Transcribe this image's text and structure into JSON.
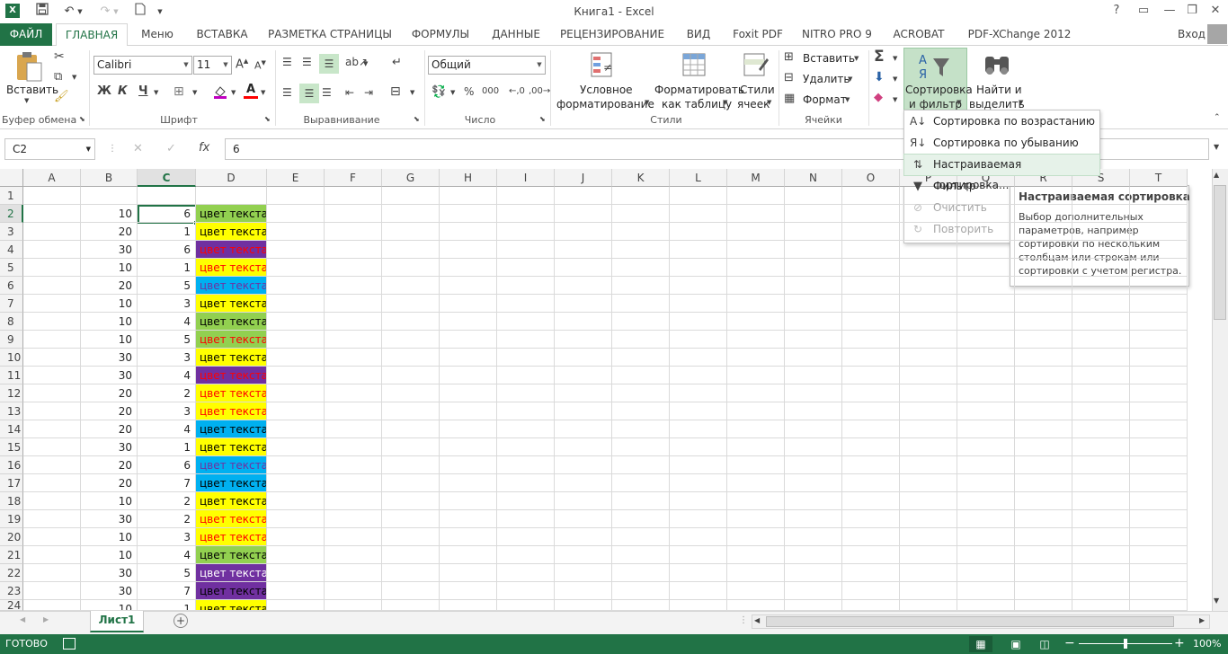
{
  "window": {
    "title": "Книга1 - Excel",
    "help": "?",
    "restore_ribbon": "▭",
    "minimize": "—",
    "maximize": "❐",
    "close": "✕"
  },
  "quick_access": {
    "icons": [
      "excel-logo-icon",
      "save-icon",
      "undo-icon",
      "redo-icon",
      "new-document-icon",
      "customize-icon"
    ]
  },
  "tabs": [
    "ФАЙЛ",
    "ГЛАВНАЯ",
    "Меню",
    "ВСТАВКА",
    "РАЗМЕТКА СТРАНИЦЫ",
    "ФОРМУЛЫ",
    "ДАННЫЕ",
    "РЕЦЕНЗИРОВАНИЕ",
    "ВИД",
    "Foxit PDF",
    "NITRO PRO 9",
    "ACROBAT",
    "PDF-XChange 2012"
  ],
  "account": {
    "login": "Вход"
  },
  "ribbon": {
    "clipboard": {
      "paste": "Вставить",
      "label": "Буфер обмена"
    },
    "font": {
      "name": "Calibri",
      "size": "11",
      "bold": "Ж",
      "italic": "К",
      "underline": "Ч",
      "font_color_letter": "A",
      "label": "Шрифт"
    },
    "alignment": {
      "label": "Выравнивание"
    },
    "number": {
      "format": "Общий",
      "percent": "%",
      "thousands": "000",
      "label": "Число"
    },
    "styles": {
      "conditional_1": "Условное",
      "conditional_2": "форматирование",
      "format_table_1": "Форматировать",
      "format_table_2": "как таблицу",
      "cell_styles_1": "Стили",
      "cell_styles_2": "ячеек",
      "label": "Стили"
    },
    "cells": {
      "insert": "Вставить",
      "delete": "Удалить",
      "format": "Формат",
      "label": "Ячейки"
    },
    "editing": {
      "sort_1": "Сортировка",
      "sort_2": "и фильтр",
      "find_1": "Найти и",
      "find_2": "выделить",
      "autosum": "Σ"
    }
  },
  "formula_bar": {
    "name_box": "C2",
    "cancel": "✕",
    "enter": "✓",
    "fx": "fx",
    "value": "6"
  },
  "columns": [
    "A",
    "B",
    "C",
    "D",
    "E",
    "F",
    "G",
    "H",
    "I",
    "J",
    "K",
    "L",
    "M",
    "N",
    "O",
    "P",
    "Q",
    "R",
    "S",
    "T"
  ],
  "rows": [
    {
      "n": "1",
      "b": "",
      "c": "",
      "d": "",
      "fill": "",
      "color": ""
    },
    {
      "n": "2",
      "b": "10",
      "c": "6",
      "d": "цвет текста",
      "fill": "#92d050",
      "color": "#000000"
    },
    {
      "n": "3",
      "b": "20",
      "c": "1",
      "d": "цвет текста",
      "fill": "#ffff00",
      "color": "#000000"
    },
    {
      "n": "4",
      "b": "30",
      "c": "6",
      "d": "цвет текста",
      "fill": "#7030a0",
      "color": "#ff0000"
    },
    {
      "n": "5",
      "b": "10",
      "c": "1",
      "d": "цвет текста",
      "fill": "#ffff00",
      "color": "#ff0000"
    },
    {
      "n": "6",
      "b": "20",
      "c": "5",
      "d": "цвет текста",
      "fill": "#00b0f0",
      "color": "#7030a0"
    },
    {
      "n": "7",
      "b": "10",
      "c": "3",
      "d": "цвет текста",
      "fill": "#ffff00",
      "color": "#000000"
    },
    {
      "n": "8",
      "b": "10",
      "c": "4",
      "d": "цвет текста",
      "fill": "#92d050",
      "color": "#000000"
    },
    {
      "n": "9",
      "b": "10",
      "c": "5",
      "d": "цвет текста",
      "fill": "#92d050",
      "color": "#ff0000"
    },
    {
      "n": "10",
      "b": "30",
      "c": "3",
      "d": "цвет текста",
      "fill": "#ffff00",
      "color": "#000000"
    },
    {
      "n": "11",
      "b": "30",
      "c": "4",
      "d": "цвет текста",
      "fill": "#7030a0",
      "color": "#ff0000"
    },
    {
      "n": "12",
      "b": "20",
      "c": "2",
      "d": "цвет текста",
      "fill": "#ffff00",
      "color": "#ff0000"
    },
    {
      "n": "13",
      "b": "20",
      "c": "3",
      "d": "цвет текста",
      "fill": "#ffff00",
      "color": "#ff0000"
    },
    {
      "n": "14",
      "b": "20",
      "c": "4",
      "d": "цвет текста",
      "fill": "#00b0f0",
      "color": "#000000"
    },
    {
      "n": "15",
      "b": "30",
      "c": "1",
      "d": "цвет текста",
      "fill": "#ffff00",
      "color": "#000000"
    },
    {
      "n": "16",
      "b": "20",
      "c": "6",
      "d": "цвет текста",
      "fill": "#00b0f0",
      "color": "#7030a0"
    },
    {
      "n": "17",
      "b": "20",
      "c": "7",
      "d": "цвет текста",
      "fill": "#00b0f0",
      "color": "#000000"
    },
    {
      "n": "18",
      "b": "10",
      "c": "2",
      "d": "цвет текста",
      "fill": "#ffff00",
      "color": "#000000"
    },
    {
      "n": "19",
      "b": "30",
      "c": "2",
      "d": "цвет текста",
      "fill": "#ffff00",
      "color": "#ff0000"
    },
    {
      "n": "20",
      "b": "10",
      "c": "3",
      "d": "цвет текста",
      "fill": "#ffff00",
      "color": "#ff0000"
    },
    {
      "n": "21",
      "b": "10",
      "c": "4",
      "d": "цвет текста",
      "fill": "#92d050",
      "color": "#000000"
    },
    {
      "n": "22",
      "b": "30",
      "c": "5",
      "d": "цвет текста",
      "fill": "#7030a0",
      "color": "#ffffff"
    },
    {
      "n": "23",
      "b": "30",
      "c": "7",
      "d": "цвет текста",
      "fill": "#7030a0",
      "color": "#000000"
    },
    {
      "n": "24",
      "b": "10",
      "c": "1",
      "d": "цвет текста",
      "fill": "#ffff00",
      "color": "#000000"
    }
  ],
  "sort_menu": {
    "items": [
      {
        "label": "Сортировка по возрастанию",
        "icon": "sort-ascending-icon",
        "enabled": true
      },
      {
        "label": "Сортировка по убыванию",
        "icon": "sort-descending-icon",
        "enabled": true
      },
      {
        "label": "Настраиваемая сортировка...",
        "icon": "custom-sort-icon",
        "enabled": true
      },
      {
        "label": "Фильтр",
        "icon": "filter-icon",
        "enabled": true
      },
      {
        "label": "Очистить",
        "icon": "clear-filter-icon",
        "enabled": false
      },
      {
        "label": "Повторить",
        "icon": "reapply-filter-icon",
        "enabled": false
      }
    ]
  },
  "tooltip": {
    "title": "Настраиваемая сортировка",
    "line1": "Выбор дополнительных",
    "line2": "параметров, например",
    "line3": "сортировки по нескольким",
    "line4": "столбцам или строкам или",
    "line5": "сортировки с учетом регистра."
  },
  "sheet_tab": "Лист1",
  "status": {
    "ready": "ГОТОВО",
    "zoom": "100%"
  },
  "colors": {
    "excel_green": "#217346",
    "highlight": "#e6f2e9",
    "underline_red": "#e00000",
    "active_cell_border": "#217346"
  }
}
